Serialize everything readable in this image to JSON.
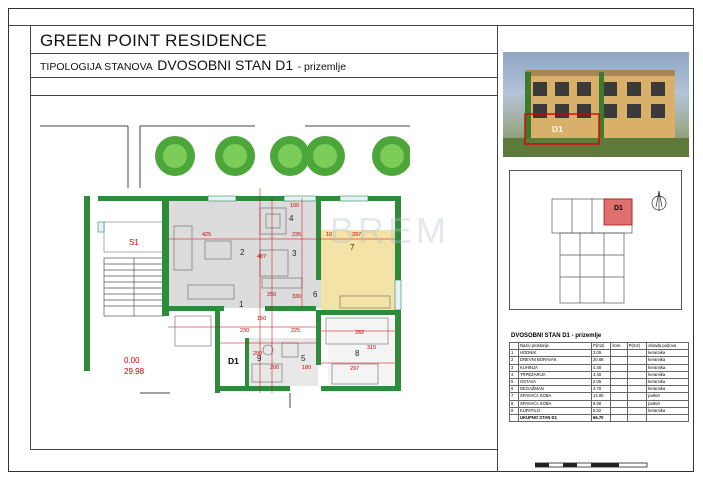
{
  "title": "GREEN POINT RESIDENCE",
  "subtitle": {
    "prefix": "TIPOLOGIJA STANOVA",
    "unit": "DVOSOBNI STAN  D1",
    "suffix": "- prizemlje"
  },
  "photo_label": "D1",
  "keyplan_label": "D1",
  "watermark": "BREM",
  "plan": {
    "rooms": [
      "1",
      "2",
      "3",
      "4",
      "5",
      "6",
      "7",
      "8",
      "9"
    ],
    "stair_label": "S1",
    "unit_label": "D1",
    "level": [
      "0.00",
      "29.98"
    ],
    "dims": [
      "425",
      "235",
      "10",
      "297",
      "225",
      "230",
      "290",
      "282",
      "315",
      "297",
      "200",
      "180",
      "150",
      "250",
      "100",
      "487",
      "330"
    ]
  },
  "table": {
    "title": "DVOSOBNI STAN D1 - prizemlje",
    "headers": [
      "",
      "Naziv prostorije",
      "P(m2)",
      "kom.",
      "P(m2)",
      "obrada podova"
    ],
    "rows": [
      [
        "1",
        "HODNIK",
        "3.05",
        "",
        "",
        "keramika"
      ],
      [
        "2",
        "DNEVNI BORAVAK",
        "20.68",
        "",
        "",
        "keramika"
      ],
      [
        "3",
        "KUHINJA",
        "4.40",
        "",
        "",
        "keramika"
      ],
      [
        "4",
        "TRPEZARIJA",
        "4.40",
        "",
        "",
        "keramika"
      ],
      [
        "5",
        "OSTAVA",
        "2.05",
        "",
        "",
        "keramika"
      ],
      [
        "6",
        "DEGAŽMAN",
        "4.70",
        "",
        "",
        "keramika"
      ],
      [
        "7",
        "SPAVAĆA SOBA",
        "14.90",
        "",
        "",
        "parket"
      ],
      [
        "8",
        "SPAVAĆA SOBA",
        "9.00",
        "",
        "",
        "parket"
      ],
      [
        "9",
        "KUPATILO",
        "5.52",
        "",
        "",
        "keramika"
      ]
    ],
    "total": [
      "",
      "UKUPNO STAN D1",
      "66.70",
      "",
      "",
      ""
    ]
  },
  "colors": {
    "wall": "#2e8b3a",
    "dimension": "#cc0000",
    "floor_tile": "#dcdcdc",
    "floor_parquet": "#f3e3a6"
  }
}
